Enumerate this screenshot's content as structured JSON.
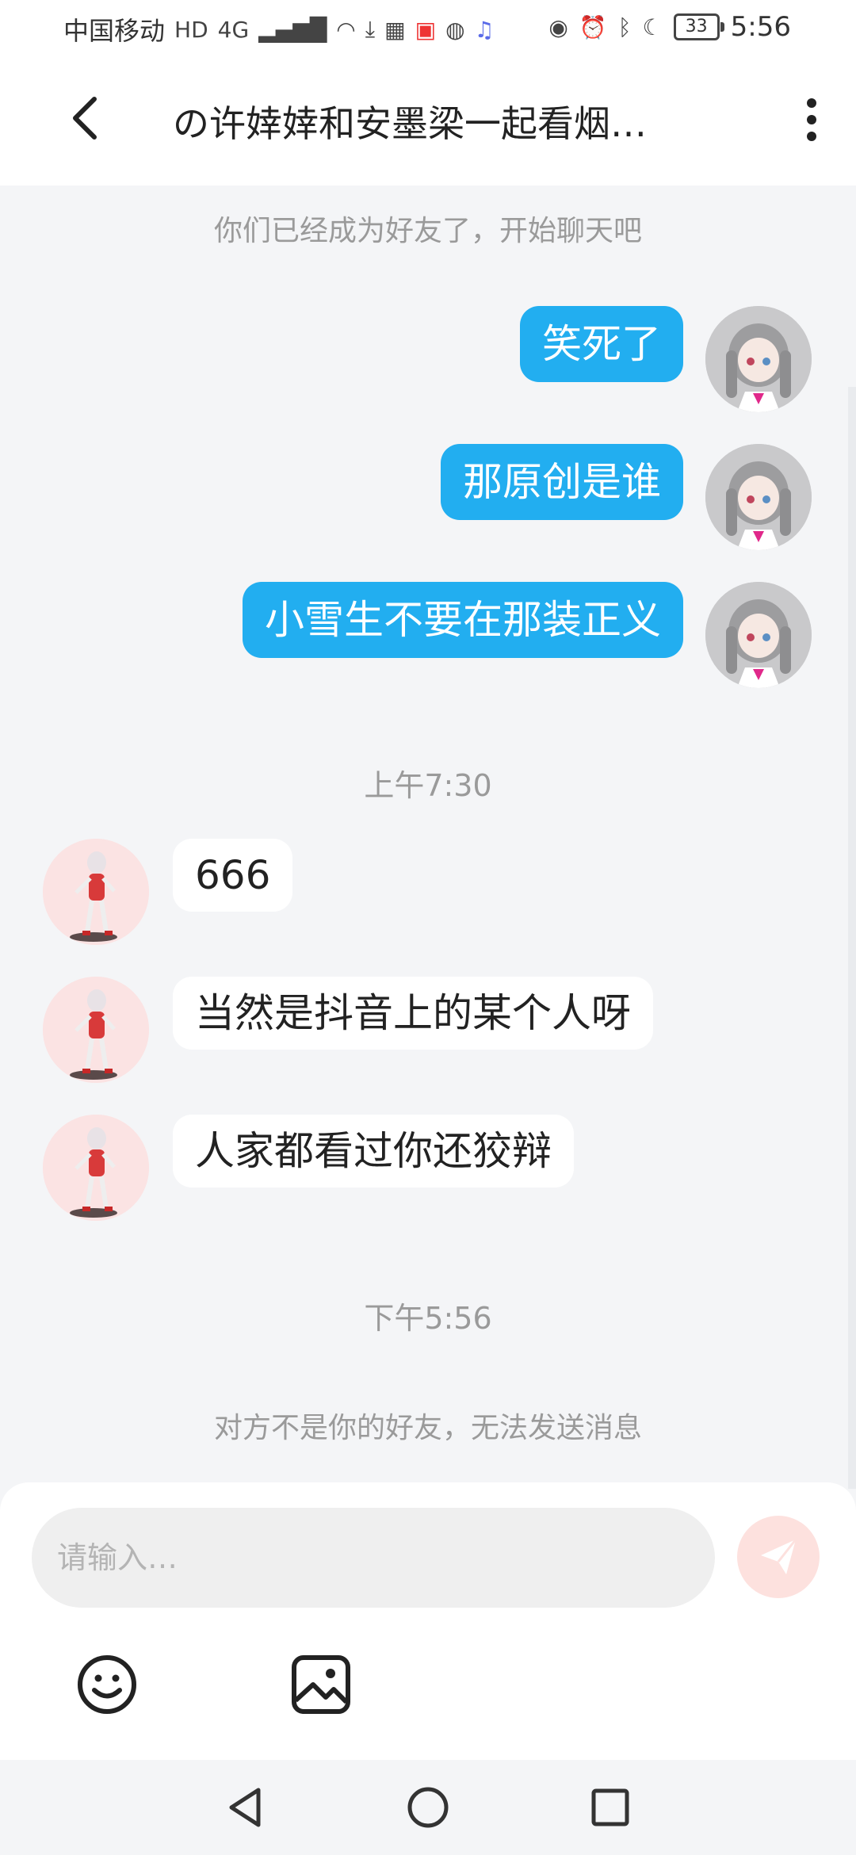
{
  "status_bar": {
    "carrier": "中国移动",
    "network": "4G",
    "battery": "33",
    "time": "5:56"
  },
  "header": {
    "title": "の许婞婞和安墨梁一起看烟…"
  },
  "messages": {
    "friend_notice": "你们已经成为好友了，开始聊天吧",
    "outgoing": [
      {
        "text": "笑死了"
      },
      {
        "text": "那原创是谁"
      },
      {
        "text": "小雪生不要在那装正义"
      }
    ],
    "time_1": "上午7:30",
    "incoming": [
      {
        "text": "666"
      },
      {
        "text": "当然是抖音上的某个人呀"
      },
      {
        "text": "人家都看过你还狡辩"
      }
    ],
    "time_2": "下午5:56",
    "not_friend_notice": "对方不是你的好友，无法发送消息"
  },
  "composer": {
    "placeholder": "请输入…",
    "value": ""
  },
  "colors": {
    "outgoing_bubble": "#22aef0",
    "send_button": "#fde1de",
    "background": "#f4f5f7"
  },
  "icons": {
    "back": "chevron-left-icon",
    "more": "more-vertical-icon",
    "send": "paper-plane-icon",
    "emoji": "smiley-icon",
    "image": "image-icon"
  }
}
